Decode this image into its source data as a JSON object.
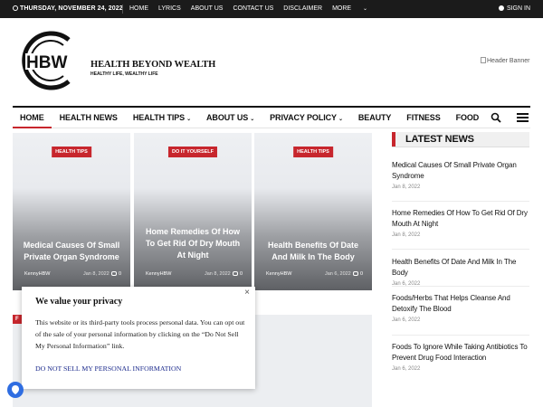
{
  "topbar": {
    "date": "THURSDAY, NOVEMBER 24, 2022",
    "links": [
      "HOME",
      "LYRICS",
      "ABOUT US",
      "CONTACT US",
      "DISCLAIMER",
      "MORE"
    ],
    "signin": "SIGN IN"
  },
  "logo": {
    "mark": "HBW",
    "name": "HEALTH BEYOND WEALTH",
    "tagline": "HEALTHY LIFE, WEALTHY LIFE"
  },
  "banner_alt": "Header Banner",
  "nav": {
    "items": [
      "HOME",
      "HEALTH NEWS",
      "HEALTH TIPS",
      "ABOUT US",
      "PRIVACY POLICY",
      "BEAUTY",
      "FITNESS",
      "FOOD"
    ]
  },
  "cards": [
    {
      "badge": "HEALTH TIPS",
      "title": "Medical Causes Of Small Private Organ Syndrome",
      "author": "KennyHBW",
      "date": "Jan 8, 2022",
      "comments": "0"
    },
    {
      "badge": "DO IT YOURSELF",
      "title": "Home Remedies Of How To Get Rid Of Dry Mouth At Night",
      "author": "KennyHBW",
      "date": "Jan 8, 2022",
      "comments": "0"
    },
    {
      "badge": "HEALTH TIPS",
      "title": "Health Benefits Of Date And Milk In The Body",
      "author": "KennyHBW",
      "date": "Jan 6, 2022",
      "comments": "0"
    }
  ],
  "lower_tag": "F",
  "sidebar": {
    "heading": "LATEST NEWS",
    "items": [
      {
        "title": "Medical Causes Of Small Private Organ Syndrome",
        "date": "Jan 8, 2022"
      },
      {
        "title": "Home Remedies Of How To Get Rid Of Dry Mouth At Night",
        "date": "Jan 8, 2022"
      },
      {
        "title": "Health Benefits Of Date And Milk In The Body",
        "date": "Jan 6, 2022"
      },
      {
        "title": "Foods/Herbs That Helps Cleanse And Detoxify The Blood",
        "date": "Jan 6, 2022"
      },
      {
        "title": "Foods To Ignore While Taking Antibiotics To Prevent Drug Food Interaction",
        "date": "Jan 6, 2022"
      }
    ]
  },
  "privacy": {
    "title": "We value your privacy",
    "body": "This website or its third-party tools process personal data. You can opt out of the sale of your personal information by clicking on the “Do Not Sell My Personal Information” link.",
    "link": "DO NOT SELL MY PERSONAL INFORMATION",
    "close": "×"
  },
  "colors": {
    "accent": "#c7262d",
    "topbar": "#1b1b1b",
    "link": "#1b2a8c"
  },
  "icons": [
    "clock-icon",
    "user-icon",
    "search-icon",
    "menu-icon",
    "comment-icon",
    "close-icon",
    "accessibility-icon"
  ]
}
